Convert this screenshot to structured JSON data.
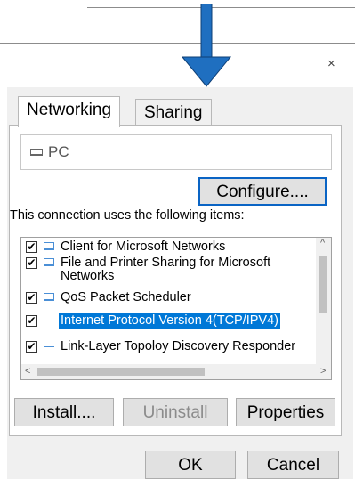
{
  "window": {
    "close_glyph": "×"
  },
  "tabs": [
    {
      "label": "Networking"
    },
    {
      "label": "Sharing"
    }
  ],
  "adapter": {
    "name": "PC",
    "icon": "computer-icon"
  },
  "buttons": {
    "configure": "Configure....",
    "install": "Install....",
    "uninstall": "Uninstall",
    "properties": "Properties",
    "ok": "OK",
    "cancel": "Cancel"
  },
  "items_label": "This connection uses the following items:",
  "check_glyph": "✔",
  "items": [
    {
      "label": "Client for Microsoft Networks",
      "checked": true,
      "icon": "network-client-icon"
    },
    {
      "label_line1": "File and Printer Sharing for Microsoft",
      "label_line2": "Networks",
      "checked": true,
      "icon": "network-service-icon"
    },
    {
      "label": "QoS Packet Scheduler",
      "checked": true,
      "icon": "network-service-icon"
    },
    {
      "label": "Internet Protocol Version 4(TCP/IPV4)",
      "checked": true,
      "selected": true,
      "icon": "protocol-icon"
    },
    {
      "label": "Link-Layer Topoloy Discovery Responder",
      "checked": true,
      "icon": "protocol-icon"
    }
  ],
  "scroll": {
    "up": "^",
    "left": "<",
    "right": ">"
  },
  "colors": {
    "accent": "#0078d7",
    "arrow": "#1f6fc0",
    "button_focus_border": "#0a64c4"
  }
}
